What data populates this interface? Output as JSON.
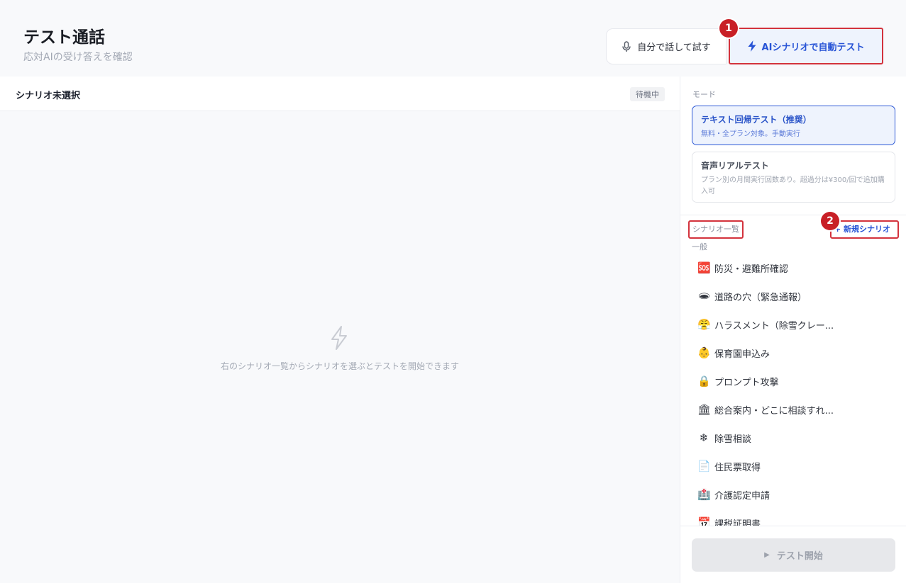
{
  "header": {
    "title": "テスト通話",
    "subtitle": "応対AIの受け答えを確認",
    "btn_self_label": "自分で話して試す",
    "btn_ai_label": "AIシナリオで自動テスト",
    "self_icon": "microphone-icon",
    "ai_icon": "lightning-icon"
  },
  "badges": {
    "one": "1",
    "two": "2"
  },
  "main": {
    "scenario_title": "シナリオ未選択",
    "status": "待機中",
    "empty_message": "右のシナリオ一覧からシナリオを選ぶとテストを開始できます",
    "empty_icon": "lightning-icon"
  },
  "sidebar": {
    "mode_label": "モード",
    "modes": [
      {
        "title": "テキスト回帰テスト（推奨）",
        "desc": "無料・全プラン対象。手動実行",
        "active": true
      },
      {
        "title": "音声リアルテスト",
        "desc": "プラン別の月間実行回数あり。超過分は¥300/回で追加購入可",
        "active": false
      }
    ],
    "list_header": "シナリオ一覧",
    "new_scenario": "+ 新規シナリオ",
    "category": "一般",
    "items": [
      {
        "icon": "🆘",
        "label": "防災・避難所確認"
      },
      {
        "icon": "🕳",
        "label": "道路の穴（緊急通報）"
      },
      {
        "icon": "😤",
        "label": "ハラスメント（除雪クレー..."
      },
      {
        "icon": "👶",
        "label": "保育園申込み"
      },
      {
        "icon": "🔒",
        "label": "プロンプト攻撃"
      },
      {
        "icon": "🏛",
        "label": "総合案内・どこに相談すれ..."
      },
      {
        "icon": "❄",
        "label": "除雪相談"
      },
      {
        "icon": "📄",
        "label": "住民票取得"
      },
      {
        "icon": "🏥",
        "label": "介護認定申請"
      },
      {
        "icon": "📅",
        "label": "課税証明書"
      }
    ],
    "start_label": "テスト開始"
  },
  "colors": {
    "accent": "#2854d6",
    "highlight": "#d3333d",
    "badge": "#c81f26"
  }
}
